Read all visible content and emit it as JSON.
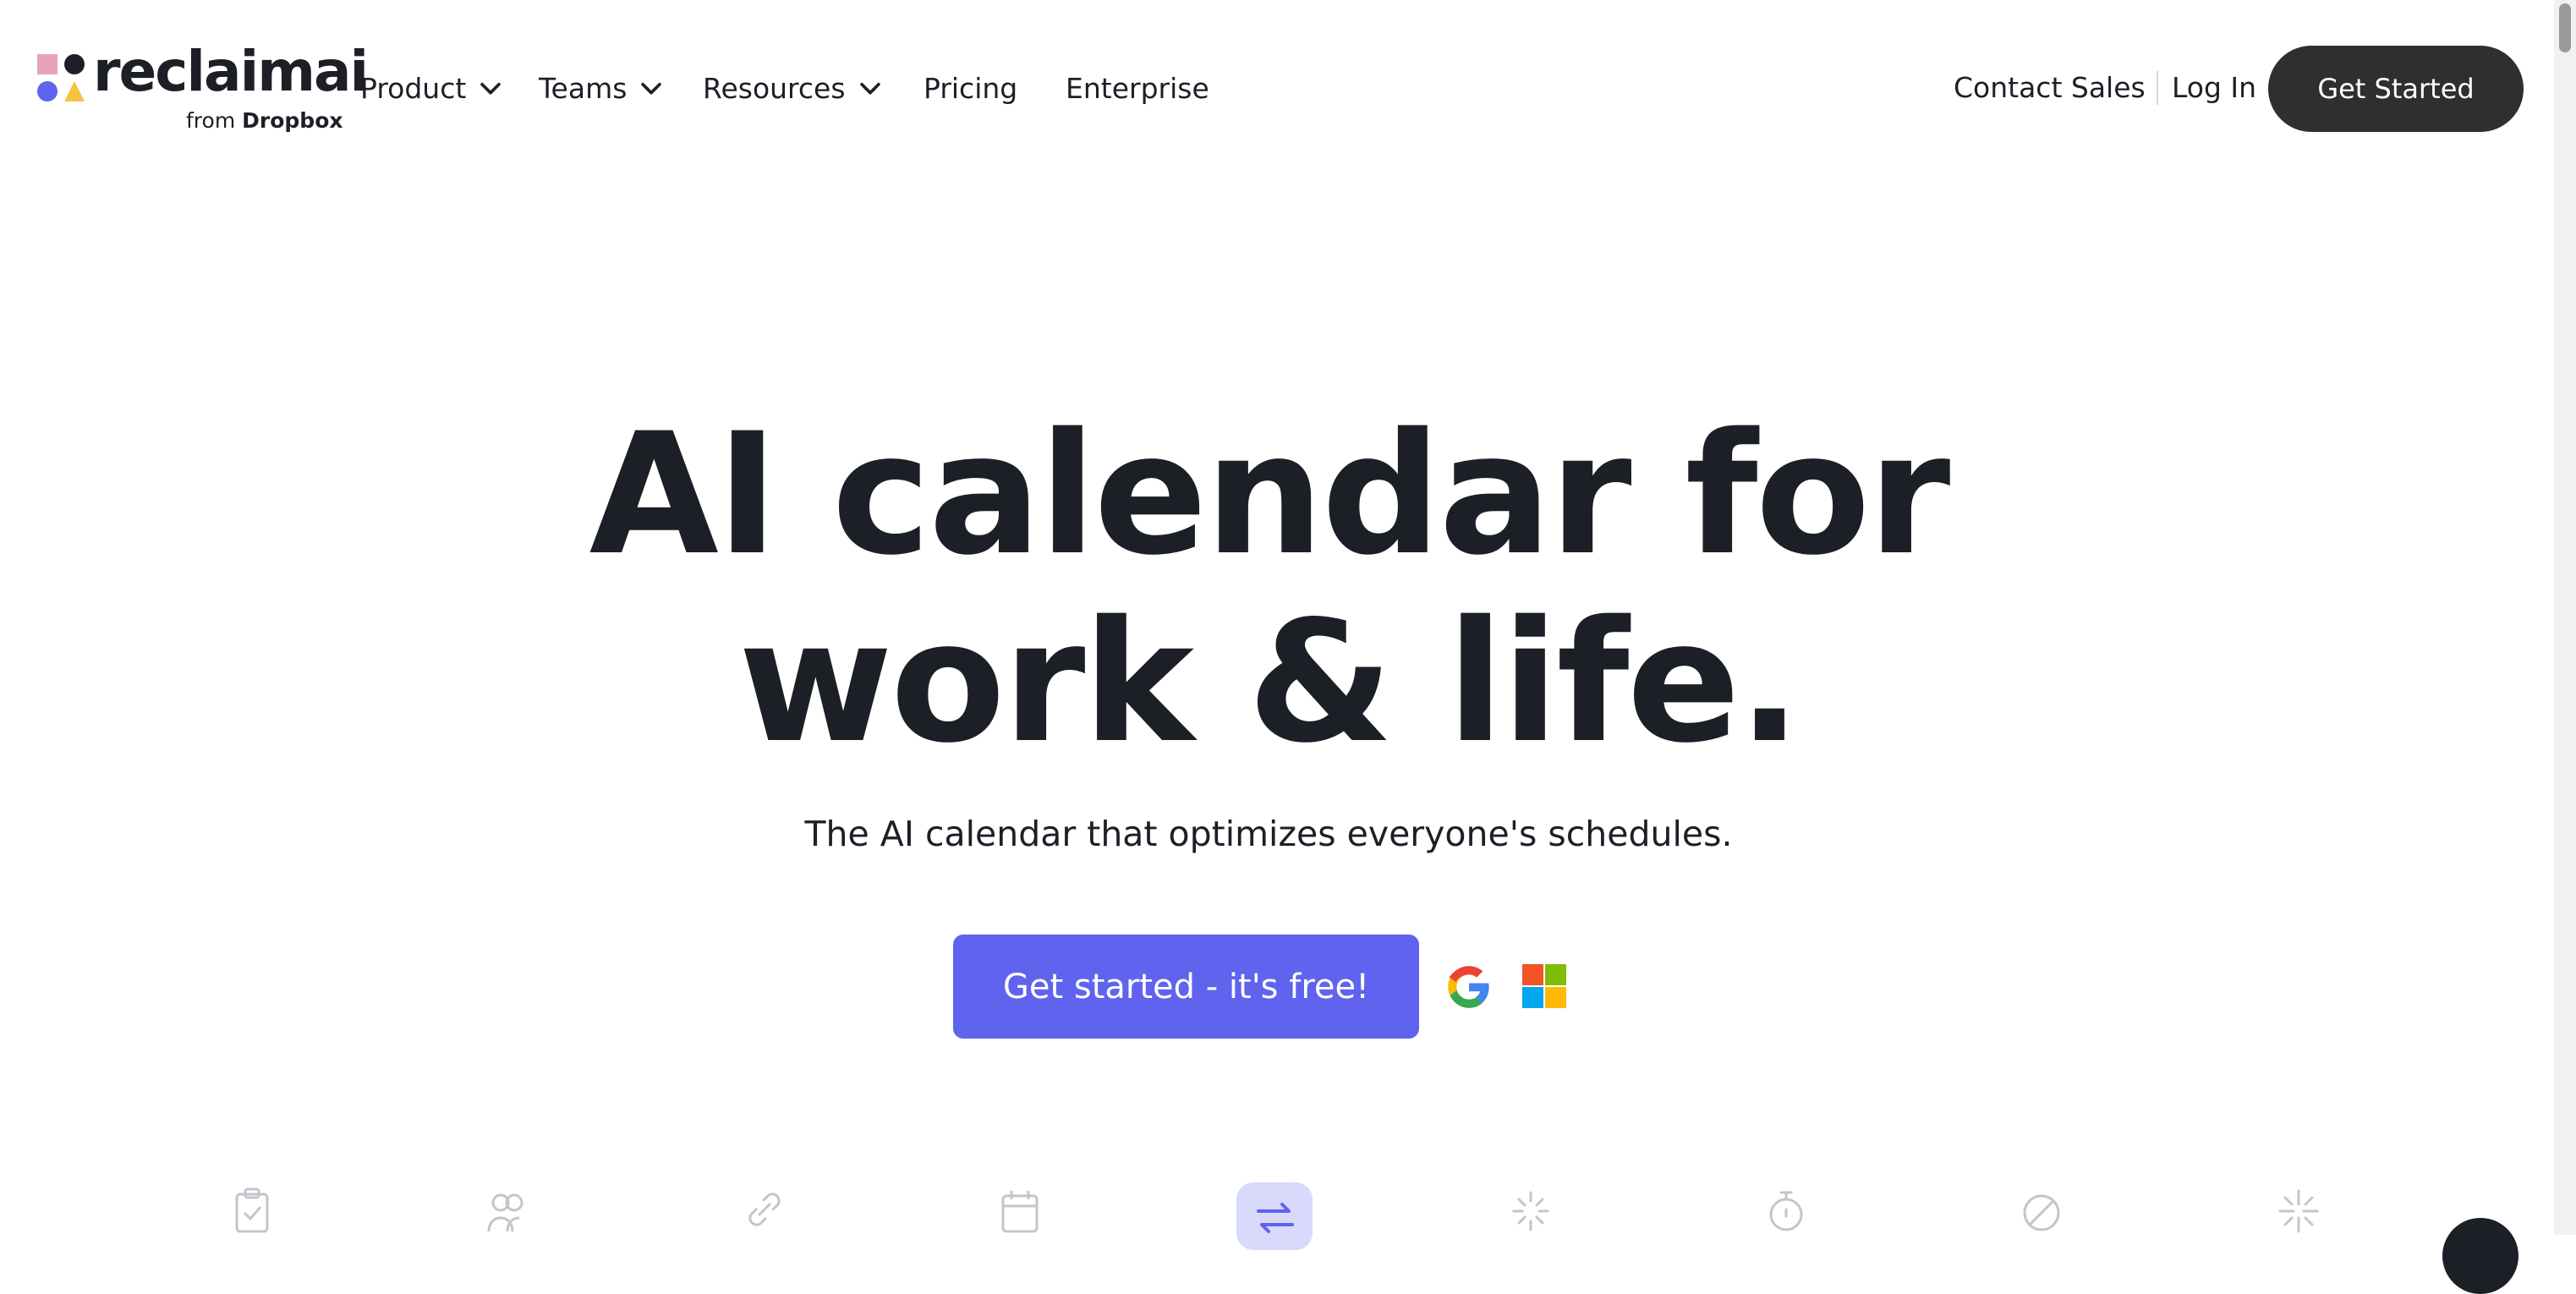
{
  "brand": {
    "name": "reclaimai",
    "sub_prefix": "from",
    "sub_brand": "Dropbox",
    "colors": {
      "pink": "#e7a3b8",
      "dark": "#1c1f26",
      "blue": "#5f63ee",
      "yellow": "#f5c242"
    }
  },
  "nav": {
    "items": [
      {
        "label": "Product",
        "dropdown": true
      },
      {
        "label": "Teams",
        "dropdown": true
      },
      {
        "label": "Resources",
        "dropdown": true
      },
      {
        "label": "Pricing",
        "dropdown": false
      },
      {
        "label": "Enterprise",
        "dropdown": false
      }
    ],
    "contact_sales": "Contact Sales",
    "log_in": "Log In",
    "get_started": "Get Started"
  },
  "hero": {
    "title_line1": "AI calendar for",
    "title_line2": "work & life.",
    "subtitle": "The AI calendar that optimizes everyone's schedules.",
    "cta_label": "Get started - it's free!",
    "integrations": [
      "google-icon",
      "microsoft-icon"
    ]
  },
  "features": {
    "icons": [
      "task-check-icon",
      "people-icon",
      "link-icon",
      "calendar-icon",
      "sync-icon",
      "loading-icon",
      "stopwatch-icon",
      "blocked-icon",
      "sparkle-icon"
    ],
    "active_icon": "sync-icon"
  },
  "colors": {
    "accent": "#5f63ee",
    "dark_button": "#2f2f2f",
    "text": "#1c1f26",
    "feature_icon": "#c4c4cc",
    "active_bg": "#d8d9fb"
  }
}
